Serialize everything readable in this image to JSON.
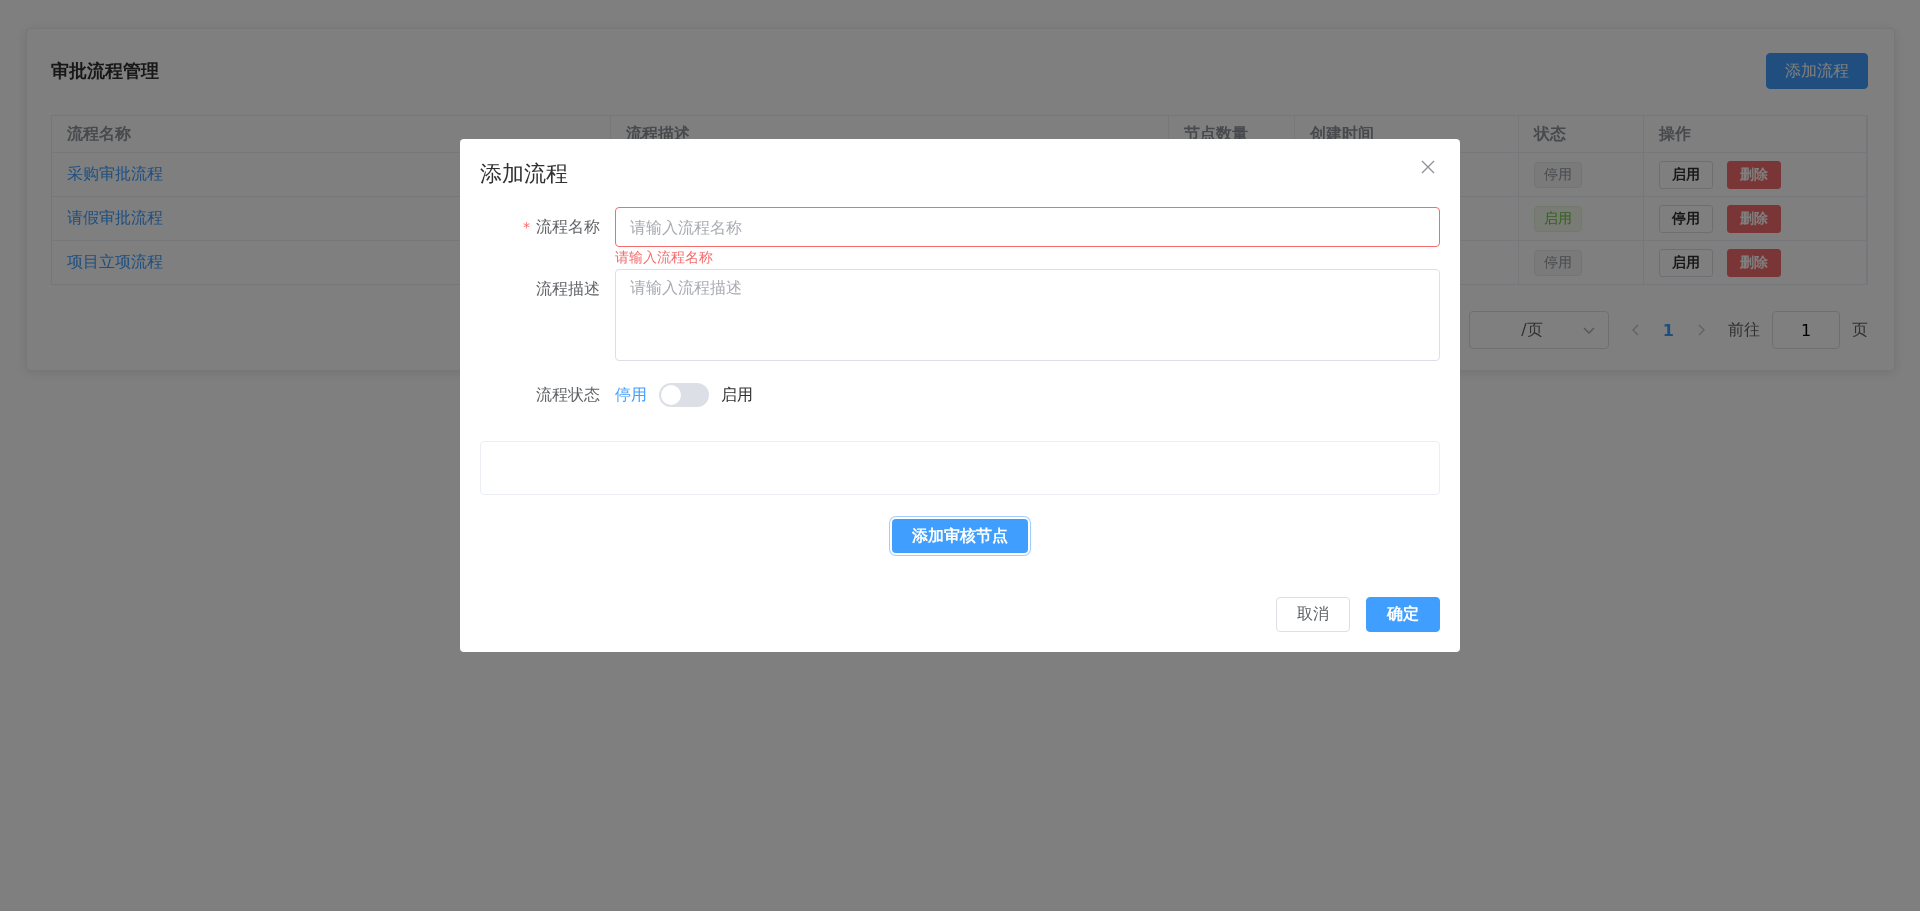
{
  "page": {
    "title": "审批流程管理",
    "add_button": "添加流程"
  },
  "table": {
    "columns": [
      "流程名称",
      "流程描述",
      "节点数量",
      "创建时间",
      "状态",
      "操作"
    ],
    "rows": [
      {
        "name": "采购审批流程",
        "status": {
          "label": "停用",
          "on": false
        },
        "toggle_button": "启用",
        "delete_button": "删除"
      },
      {
        "name": "请假审批流程",
        "status": {
          "label": "启用",
          "on": true
        },
        "toggle_button": "停用",
        "delete_button": "删除"
      },
      {
        "name": "项目立项流程",
        "status": {
          "label": "停用",
          "on": false
        },
        "toggle_button": "启用",
        "delete_button": "删除"
      }
    ]
  },
  "pagination": {
    "page_size": "/页",
    "current_page": "1",
    "goto_label": "前往",
    "goto_value": "1",
    "page_suffix": "页"
  },
  "dialog": {
    "title": "添加流程",
    "name_field": {
      "label": "流程名称",
      "required": true,
      "required_mark": "*",
      "placeholder": "请输入流程名称",
      "error": "请输入流程名称"
    },
    "description_field": {
      "label": "流程描述",
      "placeholder": "请输入流程描述"
    },
    "status_field": {
      "label": "流程状态",
      "inactive_text": "停用",
      "active_text": "启用",
      "on": false
    },
    "add_node_button": "添加审核节点",
    "cancel_button": "取消",
    "confirm_button": "确定"
  }
}
